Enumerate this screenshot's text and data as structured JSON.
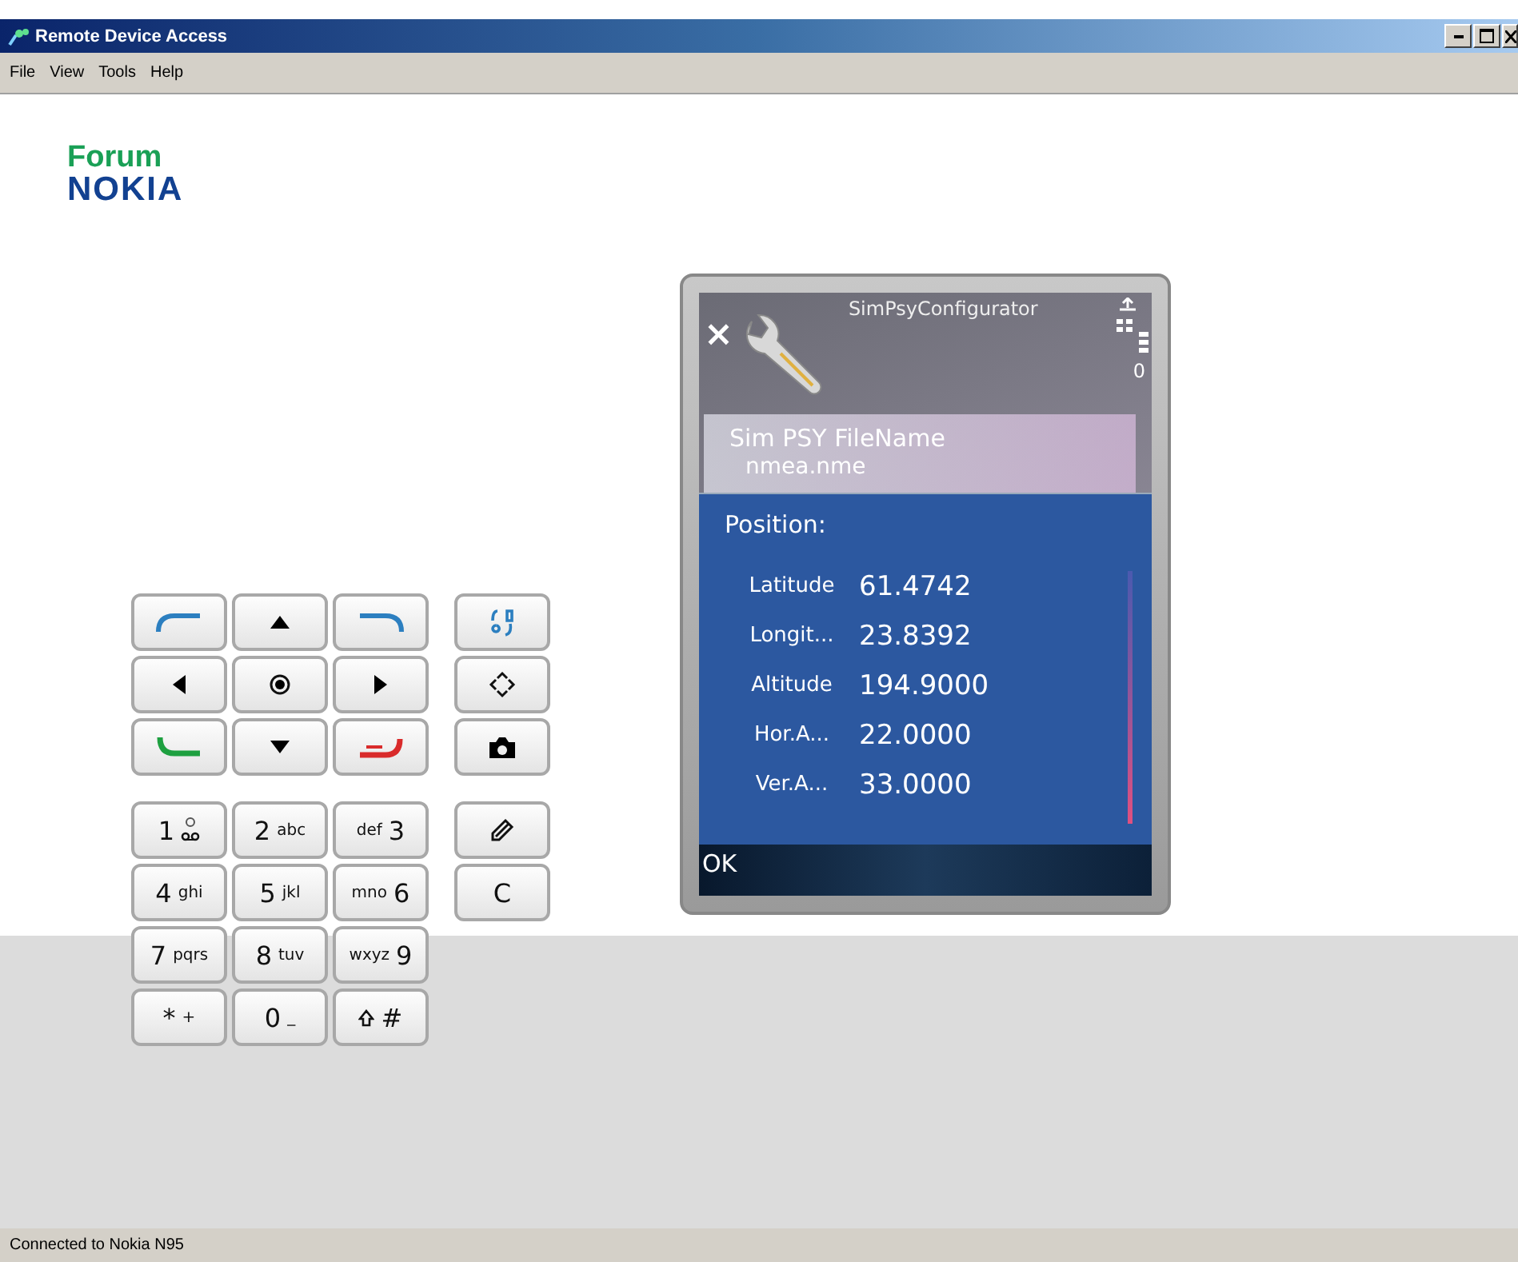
{
  "window": {
    "title": "Remote Device Access"
  },
  "menu": [
    "File",
    "View",
    "Tools",
    "Help"
  ],
  "logo": {
    "top": "Forum",
    "bottom": "NOKIA"
  },
  "keypad": {
    "nav_keys": [
      {
        "kind": "soft-left"
      },
      {
        "kind": "up"
      },
      {
        "kind": "soft-right"
      },
      {
        "kind": "left"
      },
      {
        "kind": "select"
      },
      {
        "kind": "right"
      },
      {
        "kind": "call"
      },
      {
        "kind": "down"
      },
      {
        "kind": "end"
      }
    ],
    "side_keys": [
      {
        "kind": "menu"
      },
      {
        "kind": "multimedia"
      },
      {
        "kind": "camera"
      }
    ],
    "number_keys": [
      {
        "kind": "voicemail",
        "digit": "1"
      },
      {
        "kind": "digit",
        "digit": "2",
        "letters": "abc"
      },
      {
        "kind": "letters",
        "digit": "3",
        "letters": "def"
      },
      {
        "kind": "digit",
        "digit": "4",
        "letters": "ghi"
      },
      {
        "kind": "digit",
        "digit": "5",
        "letters": "jkl"
      },
      {
        "kind": "letters",
        "digit": "6",
        "letters": "mno"
      },
      {
        "kind": "digit",
        "digit": "7",
        "letters": "pqrs"
      },
      {
        "kind": "digit",
        "digit": "8",
        "letters": "tuv"
      },
      {
        "kind": "letters",
        "digit": "9",
        "letters": "wxyz"
      },
      {
        "kind": "digit",
        "digit": "*",
        "letters": "+"
      },
      {
        "kind": "digit",
        "digit": "0",
        "letters": "_"
      },
      {
        "kind": "shift",
        "digit": "#"
      }
    ],
    "edit_keys": [
      {
        "kind": "edit"
      },
      {
        "kind": "text",
        "label": "C"
      }
    ]
  },
  "phone_screen": {
    "app_title": "SimPsyConfigurator",
    "close_glyph": "×",
    "signal_digit": "0",
    "list_item": {
      "title": "Sim PSY FileName",
      "value": "nmea.nme"
    },
    "dialog": {
      "heading": "Position:",
      "rows": [
        {
          "label": "Latitude",
          "value": "61.4742"
        },
        {
          "label": "Longit...",
          "value": "23.8392"
        },
        {
          "label": "Altitude",
          "value": "194.9000"
        },
        {
          "label": "Hor.A...",
          "value": "22.0000"
        },
        {
          "label": "Ver.A...",
          "value": "33.0000"
        }
      ]
    },
    "softkey": "OK"
  },
  "status_bar": "Connected to Nokia N95"
}
